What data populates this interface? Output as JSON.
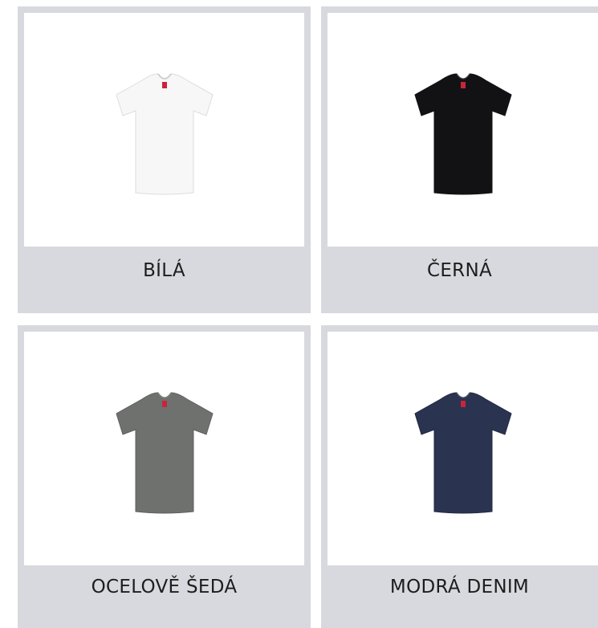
{
  "products": [
    {
      "label": "BÍLÁ",
      "color": "#f7f7f7",
      "outline": "#dddddd",
      "icon": "white-tshirt-icon"
    },
    {
      "label": "ČERNÁ",
      "color": "#121214",
      "outline": "#121214",
      "icon": "black-tshirt-icon"
    },
    {
      "label": "OCELOVĚ ŠEDÁ",
      "color": "#6f716f",
      "outline": "#5f615f",
      "icon": "steel-grey-tshirt-icon"
    },
    {
      "label": "MODRÁ DENIM",
      "color": "#2a3350",
      "outline": "#222a44",
      "icon": "denim-blue-tshirt-icon"
    }
  ]
}
